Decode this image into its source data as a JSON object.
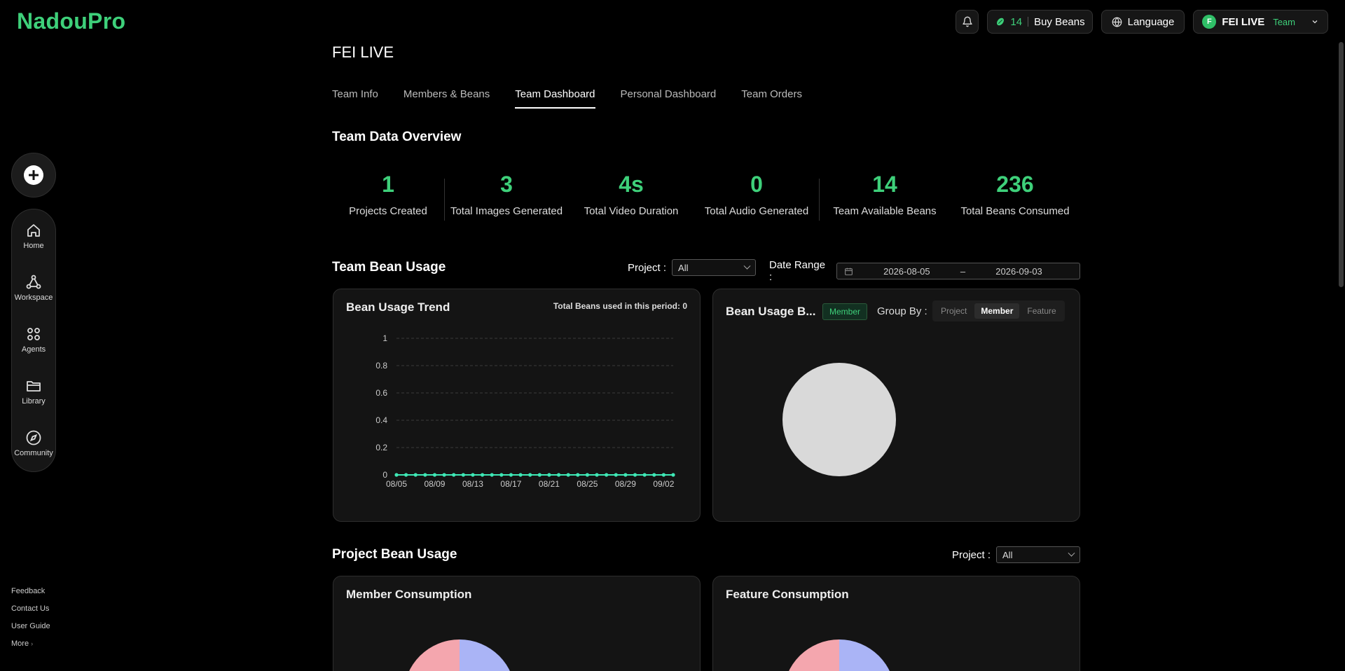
{
  "app": {
    "logo": "NadouPro"
  },
  "header": {
    "beans_count": "14",
    "buy_beans_label": "Buy Beans",
    "language_label": "Language",
    "user": {
      "initial": "F",
      "name": "FEI LIVE",
      "tag": "Team"
    }
  },
  "sidebar": {
    "create_icon": "plus-circle-icon",
    "items": [
      {
        "label": "Home",
        "icon": "home-icon"
      },
      {
        "label": "Workspace",
        "icon": "workspace-icon"
      },
      {
        "label": "Agents",
        "icon": "agents-icon"
      },
      {
        "label": "Library",
        "icon": "folder-icon"
      },
      {
        "label": "Community",
        "icon": "compass-icon"
      }
    ],
    "footer_links": [
      "Feedback",
      "Contact Us",
      "User Guide",
      "More"
    ]
  },
  "page": {
    "team_name": "FEI LIVE",
    "tabs": [
      {
        "label": "Team Info",
        "active": false
      },
      {
        "label": "Members & Beans",
        "active": false
      },
      {
        "label": "Team Dashboard",
        "active": true
      },
      {
        "label": "Personal Dashboard",
        "active": false
      },
      {
        "label": "Team Orders",
        "active": false
      }
    ],
    "overview_title": "Team Data Overview",
    "stats": [
      {
        "value": "1",
        "label": "Projects Created"
      },
      {
        "value": "3",
        "label": "Total Images Generated"
      },
      {
        "value": "4s",
        "label": "Total Video Duration"
      },
      {
        "value": "0",
        "label": "Total Audio Generated"
      },
      {
        "value": "14",
        "label": "Team Available Beans"
      },
      {
        "value": "236",
        "label": "Total Beans Consumed"
      }
    ],
    "team_bean_usage": {
      "title": "Team Bean Usage",
      "project_label": "Project :",
      "project_value": "All",
      "date_range_label": "Date Range :",
      "date_start": "2026-08-05",
      "date_sep": "–",
      "date_end": "2026-09-03"
    },
    "trend_card": {
      "title": "Bean Usage Trend",
      "note": "Total Beans used in this period: 0"
    },
    "breakdown_card": {
      "title": "Bean Usage B...",
      "badge": "Member",
      "group_by_label": "Group By :",
      "options": [
        {
          "label": "Project",
          "active": false
        },
        {
          "label": "Member",
          "active": true
        },
        {
          "label": "Feature",
          "active": false
        }
      ],
      "pie_color": "#d9d9d9"
    },
    "project_bean_usage": {
      "title": "Project Bean Usage",
      "project_label": "Project :",
      "project_value": "All"
    },
    "member_consumption_title": "Member Consumption",
    "feature_consumption_title": "Feature Consumption"
  },
  "chart_data": {
    "type": "line",
    "x": [
      "08/05",
      "08/06",
      "08/07",
      "08/08",
      "08/09",
      "08/10",
      "08/11",
      "08/12",
      "08/13",
      "08/14",
      "08/15",
      "08/16",
      "08/17",
      "08/18",
      "08/19",
      "08/20",
      "08/21",
      "08/22",
      "08/23",
      "08/24",
      "08/25",
      "08/26",
      "08/27",
      "08/28",
      "08/29",
      "08/30",
      "08/31",
      "09/01",
      "09/02",
      "09/03"
    ],
    "x_tick_labels": [
      "08/05",
      "08/09",
      "08/13",
      "08/17",
      "08/21",
      "08/25",
      "08/29",
      "09/02"
    ],
    "y_ticks": [
      "0",
      "0.2",
      "0.4",
      "0.6",
      "0.8",
      "1"
    ],
    "ylim": [
      0,
      1
    ],
    "series": [
      {
        "values": [
          0,
          0,
          0,
          0,
          0,
          0,
          0,
          0,
          0,
          0,
          0,
          0,
          0,
          0,
          0,
          0,
          0,
          0,
          0,
          0,
          0,
          0,
          0,
          0,
          0,
          0,
          0,
          0,
          0,
          0
        ],
        "color": "#3ee8b5"
      }
    ],
    "grid": true
  },
  "consumption_pie_colors": [
    "#f4a6ae",
    "#aab4f6"
  ]
}
